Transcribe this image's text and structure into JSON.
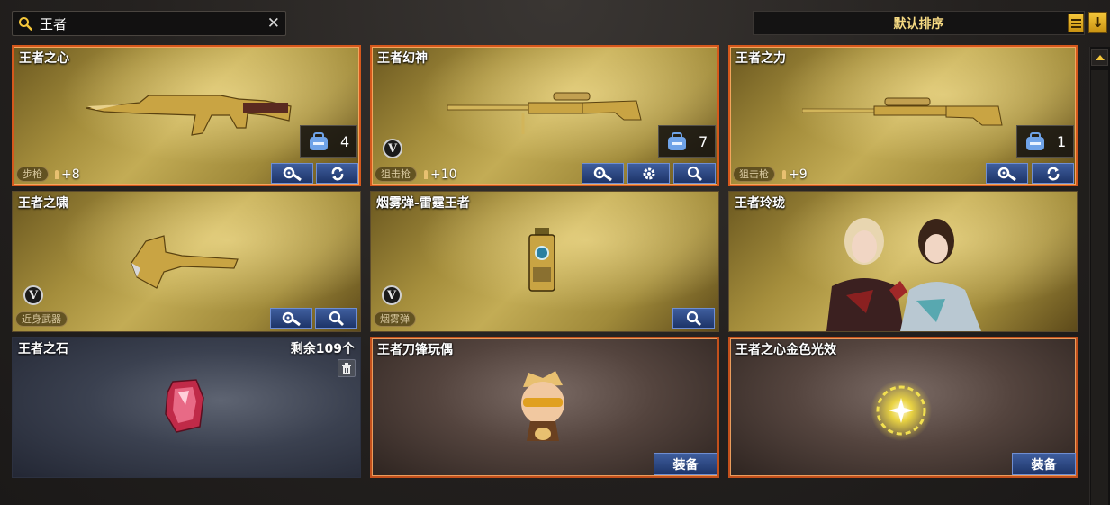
{
  "search": {
    "query": "王者"
  },
  "sort": {
    "label": "默认排序"
  },
  "items": [
    {
      "title": "王者之心",
      "count": "4",
      "type": "步枪",
      "enhance": "+8"
    },
    {
      "title": "王者幻神",
      "count": "7",
      "badge": "V",
      "type": "狙击枪",
      "enhance": "+10"
    },
    {
      "title": "王者之力",
      "count": "1",
      "type": "狙击枪",
      "enhance": "+9"
    },
    {
      "title": "王者之啸",
      "badge": "V",
      "type": "近身武器"
    },
    {
      "title": "烟雾弹-雷霆王者",
      "badge": "V",
      "type": "烟雾弹"
    },
    {
      "title": "王者玲珑"
    },
    {
      "title": "王者之石",
      "remaining": "剩余109个"
    },
    {
      "title": "王者刀锋玩偶",
      "equip": "装备"
    },
    {
      "title": "王者之心金色光效",
      "equip": "装备"
    }
  ],
  "icons": {
    "search": "search-icon",
    "clear": "close-icon",
    "list": "list-icon",
    "sort_direction": "arrow-down-icon",
    "scroll_up": "triangle-up-icon",
    "backpack": "backpack-icon",
    "repair": "wrench-gear-icon",
    "settings": "gear-icon",
    "renew": "renew-icon",
    "preview": "search-icon",
    "trash": "trash-icon",
    "v_badge": "v-badge-icon"
  },
  "colors": {
    "accent_gold": "#f4c63a",
    "active_border": "#d5581c",
    "button_blue": "#2a467f"
  }
}
